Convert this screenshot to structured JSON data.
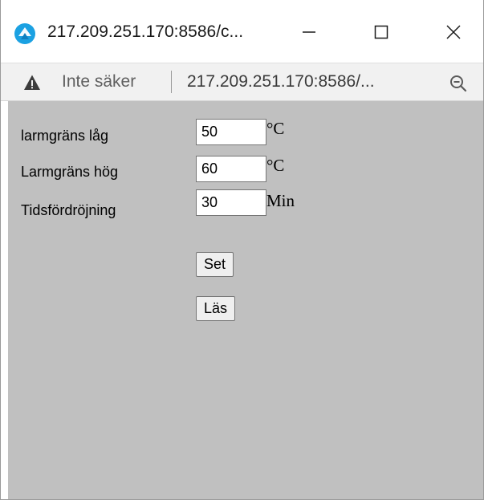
{
  "window": {
    "title": "217.209.251.170:8586/c..."
  },
  "addressbar": {
    "security_label": "Inte säker",
    "url": "217.209.251.170:8586/..."
  },
  "form": {
    "fields": [
      {
        "label": "larmgräns låg",
        "value": "50",
        "unit": "°C"
      },
      {
        "label": "Larmgräns hög",
        "value": "60",
        "unit": "°C"
      },
      {
        "label": "Tidsfördröjning",
        "value": "30",
        "unit": "Min"
      }
    ],
    "set_label": "Set",
    "read_label": "Läs"
  },
  "colors": {
    "page_background": "#c0c0c0",
    "app_icon": "#1ba1e2",
    "warning_icon": "#3c3c3c"
  },
  "icons": {
    "app": "browser-app-icon",
    "warning": "warning-triangle-icon",
    "zoom": "zoom-out-icon",
    "minimize": "minimize-icon",
    "maximize": "maximize-icon",
    "close": "close-icon"
  }
}
